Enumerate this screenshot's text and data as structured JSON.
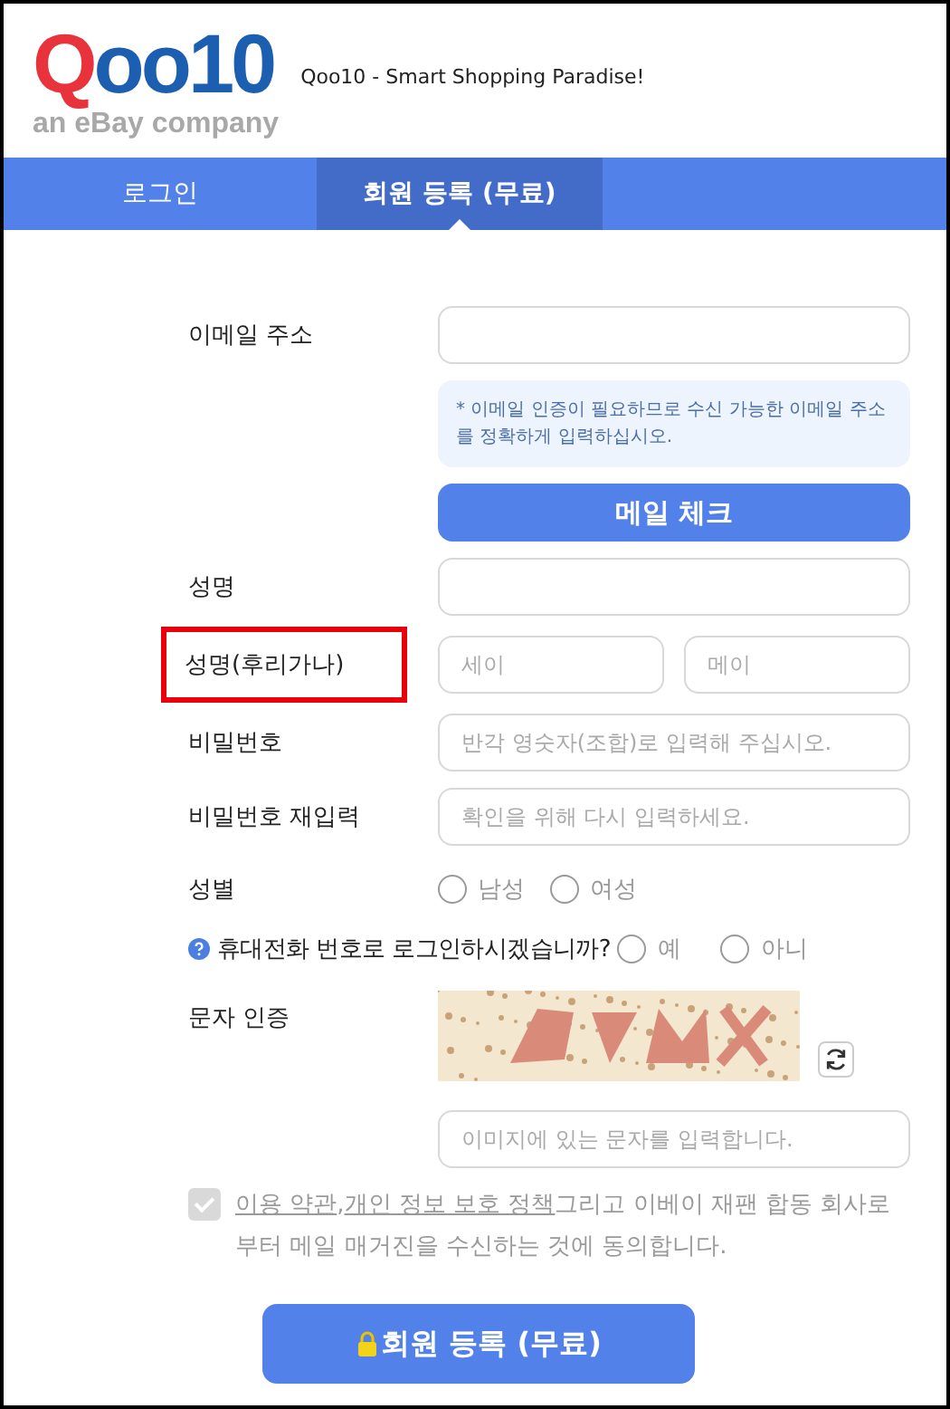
{
  "header": {
    "logo_parts": [
      "Q",
      "oo10"
    ],
    "logo_tagline": "an eBay company",
    "slogan": "Qoo10 - Smart Shopping Paradise!"
  },
  "tabs": [
    {
      "label": "로그인",
      "selected": false
    },
    {
      "label": "회원 등록 (무료)",
      "selected": true
    }
  ],
  "rows": [
    {
      "kind": "input",
      "label": "이메일 주소"
    },
    {
      "kind": "note",
      "text": "* 이메일 인증이 필요하므로 수신 가능한 이메일 주소를 정확하게 입력하십시오."
    },
    {
      "kind": "button",
      "label": "메일 체크"
    },
    {
      "kind": "input",
      "label": "성명"
    },
    {
      "kind": "split",
      "label": "성명(후리가나)",
      "highlighted": true,
      "placeholders": [
        "세이",
        "메이"
      ]
    },
    {
      "kind": "input",
      "label": "비밀번호",
      "placeholder": "반각 영숫자(조합)로 입력해 주십시오."
    },
    {
      "kind": "input",
      "label": "비밀번호 재입력",
      "placeholder": "확인을 위해 다시 입력하세요."
    },
    {
      "kind": "radio",
      "label": "성별",
      "options": [
        {
          "label": "남성",
          "selected": false
        },
        {
          "label": "여성",
          "selected": false
        }
      ]
    },
    {
      "kind": "question",
      "label": "휴대전화 번호로 로그인하시겠습니까?",
      "options": [
        {
          "label": "예",
          "selected": false
        },
        {
          "label": "아니",
          "selected": false
        }
      ]
    },
    {
      "kind": "captcha",
      "label": "문자 인증"
    },
    {
      "kind": "input",
      "placeholder": "이미지에 있는 문자를 입력합니다."
    }
  ],
  "agreement": {
    "checked": true,
    "disabled": true,
    "links": [
      "이용 약관",
      "개인 정보 보호 정책"
    ],
    "separator": ",",
    "text": "그리고 이베이 재팬 합동 회사로부터 메일 매거진을 수신하는 것에 동의합니다."
  },
  "submit": {
    "label": "회원 등록 (무료)"
  }
}
